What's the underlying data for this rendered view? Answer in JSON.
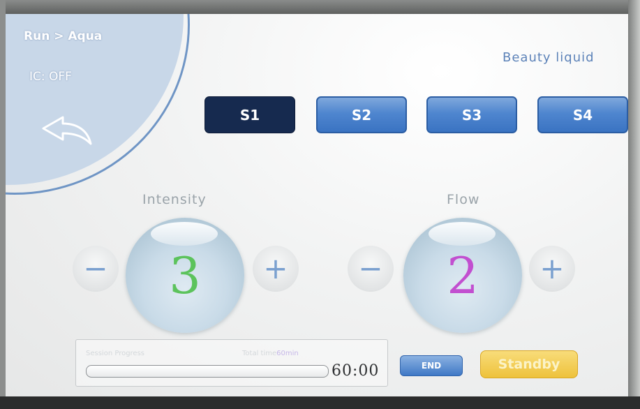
{
  "nav": {
    "breadcrumb": "Run > Aqua",
    "ic_status": "IC: OFF",
    "back_icon": "back-arrow-icon"
  },
  "mode_label": "Beauty liquid",
  "solutions": {
    "items": [
      {
        "label": "S1",
        "active": true
      },
      {
        "label": "S2",
        "active": false
      },
      {
        "label": "S3",
        "active": false
      },
      {
        "label": "S4",
        "active": false
      }
    ]
  },
  "intensity": {
    "label": "Intensity",
    "value": "3",
    "minus": "−",
    "plus": "+",
    "value_color": "#5cc35c"
  },
  "flow": {
    "label": "Flow",
    "value": "2",
    "minus": "−",
    "plus": "+",
    "value_color": "#c24fd0"
  },
  "session": {
    "progress_label": "Session Progress",
    "total_label": "Total time",
    "total_value": "60min",
    "progress_fraction": 0,
    "time_remaining": "60:00"
  },
  "actions": {
    "end_label": "END",
    "standby_label": "Standby"
  },
  "colors": {
    "accent_blue": "#4f86cf",
    "active_dark": "#162a4f",
    "standby_yellow": "#eec23b"
  }
}
